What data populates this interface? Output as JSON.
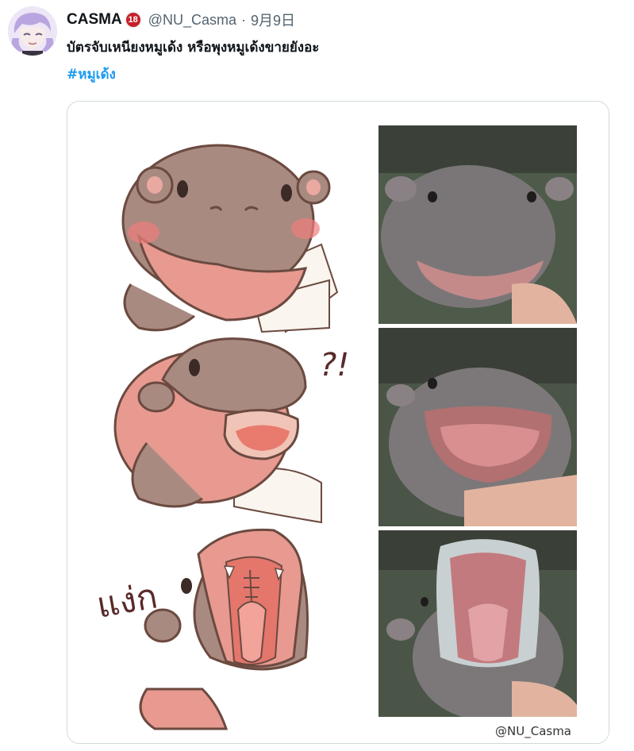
{
  "tweet": {
    "display_name": "CASMA",
    "badge": "18",
    "handle": "@NU_Casma",
    "separator": "·",
    "date": "9月9日",
    "text": "บัตรจับเหนียงหมูเด้ง หรือพุงหมูเด้งขายยังอะ",
    "hashtag": "#หมูเด้ง"
  },
  "media": {
    "sfx_surprise": "?!",
    "sfx_yawn": "แง่ก",
    "watermark": "@NU_Casma"
  },
  "colors": {
    "link": "#1d9bf0",
    "text": "#0f1419",
    "muted": "#536471",
    "badge": "#c5202a"
  }
}
